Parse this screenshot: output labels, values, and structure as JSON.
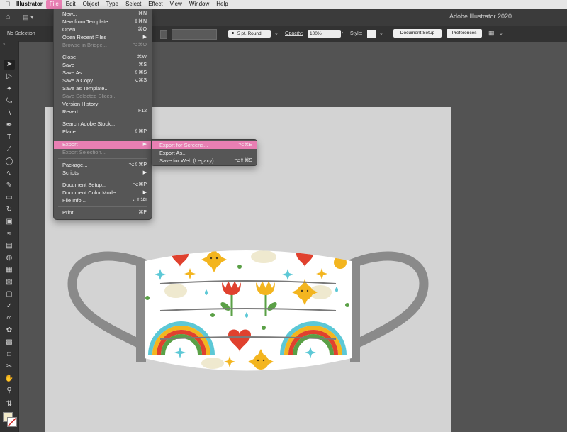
{
  "menubar": {
    "apple": "",
    "app": "Illustrator",
    "items": [
      "File",
      "Edit",
      "Object",
      "Type",
      "Select",
      "Effect",
      "View",
      "Window",
      "Help"
    ]
  },
  "appbar": {
    "title": "Adobe Illustrator 2020"
  },
  "control_bar": {
    "selection": "No Selection",
    "stroke_profile": "5 pt. Round",
    "opacity_label": "Opacity:",
    "opacity_value": "100%",
    "style_label": "Style:",
    "document_setup": "Document Setup",
    "preferences": "Preferences"
  },
  "file_menu": {
    "new": {
      "label": "New...",
      "shortcut": "⌘N"
    },
    "new_template": {
      "label": "New from Template...",
      "shortcut": "⇧⌘N"
    },
    "open": {
      "label": "Open...",
      "shortcut": "⌘O"
    },
    "open_recent": {
      "label": "Open Recent Files",
      "shortcut": "▶"
    },
    "browse_bridge": {
      "label": "Browse in Bridge...",
      "shortcut": "⌥⌘O"
    },
    "close": {
      "label": "Close",
      "shortcut": "⌘W"
    },
    "save": {
      "label": "Save",
      "shortcut": "⌘S"
    },
    "save_as": {
      "label": "Save As...",
      "shortcut": "⇧⌘S"
    },
    "save_copy": {
      "label": "Save a Copy...",
      "shortcut": "⌥⌘S"
    },
    "save_template": {
      "label": "Save as Template...",
      "shortcut": ""
    },
    "save_slices": {
      "label": "Save Selected Slices...",
      "shortcut": ""
    },
    "version_history": {
      "label": "Version History",
      "shortcut": ""
    },
    "revert": {
      "label": "Revert",
      "shortcut": "F12"
    },
    "search_stock": {
      "label": "Search Adobe Stock...",
      "shortcut": ""
    },
    "place": {
      "label": "Place...",
      "shortcut": "⇧⌘P"
    },
    "export": {
      "label": "Export",
      "shortcut": "▶"
    },
    "export_selection": {
      "label": "Export Selection...",
      "shortcut": ""
    },
    "package": {
      "label": "Package...",
      "shortcut": "⌥⇧⌘P"
    },
    "scripts": {
      "label": "Scripts",
      "shortcut": "▶"
    },
    "document_setup": {
      "label": "Document Setup...",
      "shortcut": "⌥⌘P"
    },
    "document_color_mode": {
      "label": "Document Color Mode",
      "shortcut": "▶"
    },
    "file_info": {
      "label": "File Info...",
      "shortcut": "⌥⇧⌘I"
    },
    "print": {
      "label": "Print...",
      "shortcut": "⌘P"
    }
  },
  "export_submenu": {
    "screens": {
      "label": "Export for Screens...",
      "shortcut": "⌥⌘E"
    },
    "as": {
      "label": "Export As...",
      "shortcut": ""
    },
    "web": {
      "label": "Save for Web (Legacy)...",
      "shortcut": "⌥⇧⌘S"
    }
  },
  "colors": {
    "highlight": "#e87fb3",
    "menu_bg": "#565656",
    "artboard": "#d3d3d3",
    "mask_strap": "#8a8a8a"
  }
}
